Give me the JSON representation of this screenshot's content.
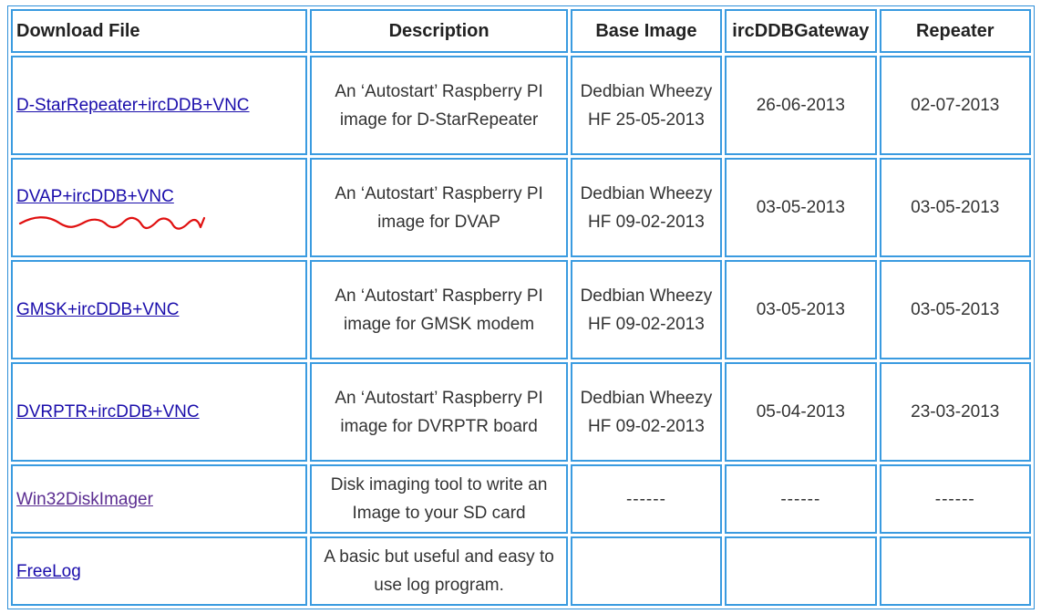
{
  "headers": [
    "Download File",
    "Description",
    "Base Image",
    "ircDDBGateway",
    "Repeater"
  ],
  "rows": [
    {
      "file": "D-StarRepeater+ircDDB+VNC",
      "description": "An ‘Autostart’ Raspberry PI image for D-StarRepeater",
      "base_image": "Dedbian Wheezy HF 25-05-2013",
      "ircddbgateway": "26-06-2013",
      "repeater": "02-07-2013"
    },
    {
      "file": "DVAP+ircDDB+VNC",
      "description": "An ‘Autostart’ Raspberry PI image for DVAP",
      "base_image": "Dedbian Wheezy HF 09-02-2013",
      "ircddbgateway": "03-05-2013",
      "repeater": "03-05-2013"
    },
    {
      "file": "GMSK+ircDDB+VNC",
      "description": "An ‘Autostart’ Raspberry PI image for GMSK modem",
      "base_image": "Dedbian Wheezy HF 09-02-2013",
      "ircddbgateway": "03-05-2013",
      "repeater": "03-05-2013"
    },
    {
      "file": "DVRPTR+ircDDB+VNC",
      "description": "An ‘Autostart’ Raspberry PI image for DVRPTR board",
      "base_image": "Dedbian Wheezy HF 09-02-2013",
      "ircddbgateway": "05-04-2013",
      "repeater": "23-03-2013"
    },
    {
      "file": "Win32DiskImager",
      "description": "Disk imaging tool to write an Image to your SD card",
      "base_image": "------",
      "ircddbgateway": "------",
      "repeater": "------"
    },
    {
      "file": "FreeLog",
      "description": "A basic but useful and easy to use log program.",
      "base_image": "",
      "ircddbgateway": "",
      "repeater": ""
    }
  ],
  "colors": {
    "border": "#3a9be0",
    "link": "#1a0dab",
    "visited_link": "#5b2d91",
    "annotation": "#e01010"
  },
  "annotation": {
    "icon": "red-squiggle-underline-icon",
    "row": 1
  }
}
